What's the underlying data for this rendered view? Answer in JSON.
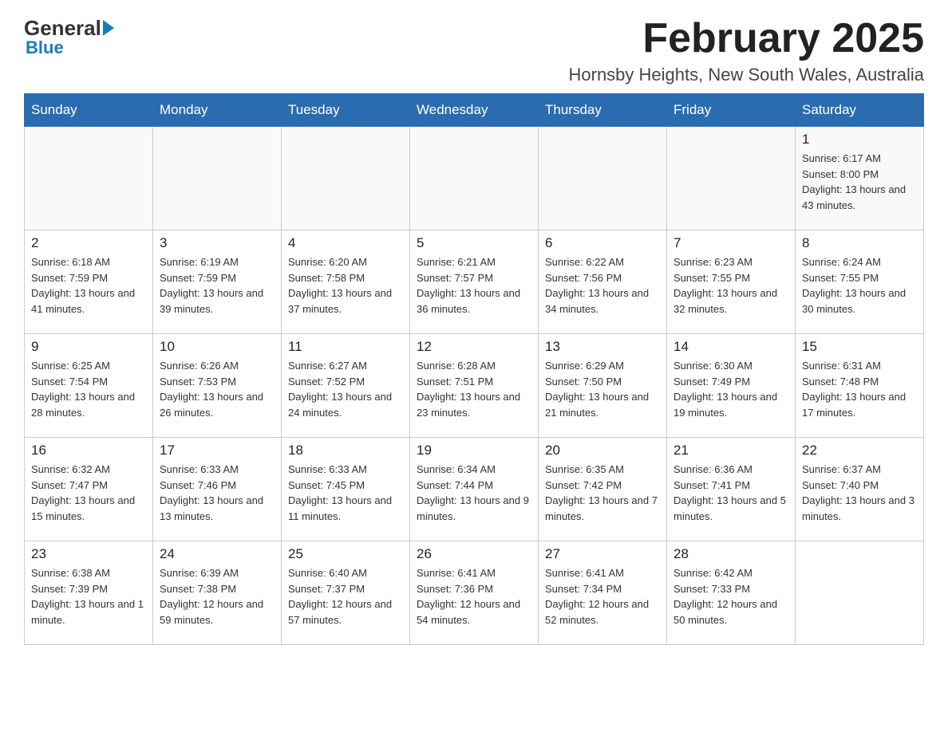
{
  "header": {
    "logo_general": "General",
    "logo_blue": "Blue",
    "month_title": "February 2025",
    "location": "Hornsby Heights, New South Wales, Australia"
  },
  "weekdays": [
    "Sunday",
    "Monday",
    "Tuesday",
    "Wednesday",
    "Thursday",
    "Friday",
    "Saturday"
  ],
  "weeks": [
    [
      {
        "day": "",
        "info": ""
      },
      {
        "day": "",
        "info": ""
      },
      {
        "day": "",
        "info": ""
      },
      {
        "day": "",
        "info": ""
      },
      {
        "day": "",
        "info": ""
      },
      {
        "day": "",
        "info": ""
      },
      {
        "day": "1",
        "info": "Sunrise: 6:17 AM\nSunset: 8:00 PM\nDaylight: 13 hours and 43 minutes."
      }
    ],
    [
      {
        "day": "2",
        "info": "Sunrise: 6:18 AM\nSunset: 7:59 PM\nDaylight: 13 hours and 41 minutes."
      },
      {
        "day": "3",
        "info": "Sunrise: 6:19 AM\nSunset: 7:59 PM\nDaylight: 13 hours and 39 minutes."
      },
      {
        "day": "4",
        "info": "Sunrise: 6:20 AM\nSunset: 7:58 PM\nDaylight: 13 hours and 37 minutes."
      },
      {
        "day": "5",
        "info": "Sunrise: 6:21 AM\nSunset: 7:57 PM\nDaylight: 13 hours and 36 minutes."
      },
      {
        "day": "6",
        "info": "Sunrise: 6:22 AM\nSunset: 7:56 PM\nDaylight: 13 hours and 34 minutes."
      },
      {
        "day": "7",
        "info": "Sunrise: 6:23 AM\nSunset: 7:55 PM\nDaylight: 13 hours and 32 minutes."
      },
      {
        "day": "8",
        "info": "Sunrise: 6:24 AM\nSunset: 7:55 PM\nDaylight: 13 hours and 30 minutes."
      }
    ],
    [
      {
        "day": "9",
        "info": "Sunrise: 6:25 AM\nSunset: 7:54 PM\nDaylight: 13 hours and 28 minutes."
      },
      {
        "day": "10",
        "info": "Sunrise: 6:26 AM\nSunset: 7:53 PM\nDaylight: 13 hours and 26 minutes."
      },
      {
        "day": "11",
        "info": "Sunrise: 6:27 AM\nSunset: 7:52 PM\nDaylight: 13 hours and 24 minutes."
      },
      {
        "day": "12",
        "info": "Sunrise: 6:28 AM\nSunset: 7:51 PM\nDaylight: 13 hours and 23 minutes."
      },
      {
        "day": "13",
        "info": "Sunrise: 6:29 AM\nSunset: 7:50 PM\nDaylight: 13 hours and 21 minutes."
      },
      {
        "day": "14",
        "info": "Sunrise: 6:30 AM\nSunset: 7:49 PM\nDaylight: 13 hours and 19 minutes."
      },
      {
        "day": "15",
        "info": "Sunrise: 6:31 AM\nSunset: 7:48 PM\nDaylight: 13 hours and 17 minutes."
      }
    ],
    [
      {
        "day": "16",
        "info": "Sunrise: 6:32 AM\nSunset: 7:47 PM\nDaylight: 13 hours and 15 minutes."
      },
      {
        "day": "17",
        "info": "Sunrise: 6:33 AM\nSunset: 7:46 PM\nDaylight: 13 hours and 13 minutes."
      },
      {
        "day": "18",
        "info": "Sunrise: 6:33 AM\nSunset: 7:45 PM\nDaylight: 13 hours and 11 minutes."
      },
      {
        "day": "19",
        "info": "Sunrise: 6:34 AM\nSunset: 7:44 PM\nDaylight: 13 hours and 9 minutes."
      },
      {
        "day": "20",
        "info": "Sunrise: 6:35 AM\nSunset: 7:42 PM\nDaylight: 13 hours and 7 minutes."
      },
      {
        "day": "21",
        "info": "Sunrise: 6:36 AM\nSunset: 7:41 PM\nDaylight: 13 hours and 5 minutes."
      },
      {
        "day": "22",
        "info": "Sunrise: 6:37 AM\nSunset: 7:40 PM\nDaylight: 13 hours and 3 minutes."
      }
    ],
    [
      {
        "day": "23",
        "info": "Sunrise: 6:38 AM\nSunset: 7:39 PM\nDaylight: 13 hours and 1 minute."
      },
      {
        "day": "24",
        "info": "Sunrise: 6:39 AM\nSunset: 7:38 PM\nDaylight: 12 hours and 59 minutes."
      },
      {
        "day": "25",
        "info": "Sunrise: 6:40 AM\nSunset: 7:37 PM\nDaylight: 12 hours and 57 minutes."
      },
      {
        "day": "26",
        "info": "Sunrise: 6:41 AM\nSunset: 7:36 PM\nDaylight: 12 hours and 54 minutes."
      },
      {
        "day": "27",
        "info": "Sunrise: 6:41 AM\nSunset: 7:34 PM\nDaylight: 12 hours and 52 minutes."
      },
      {
        "day": "28",
        "info": "Sunrise: 6:42 AM\nSunset: 7:33 PM\nDaylight: 12 hours and 50 minutes."
      },
      {
        "day": "",
        "info": ""
      }
    ]
  ]
}
